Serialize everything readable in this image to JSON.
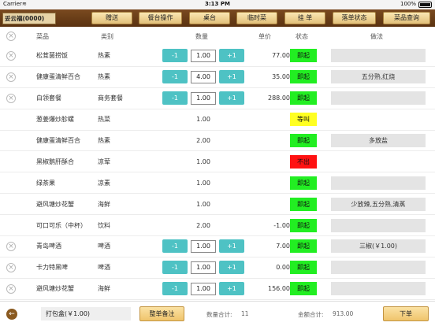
{
  "status_bar": {
    "carrier": "Carrier",
    "time": "3:13 PM",
    "battery": "100%"
  },
  "toolbar": {
    "table_name": "妥云福(0000)",
    "buttons": [
      "赠送",
      "餐台操作",
      "桌台",
      "临时菜",
      "挂 单",
      "落单状态",
      "菜品查询"
    ]
  },
  "header": {
    "name": "菜品",
    "category": "类别",
    "qty": "数量",
    "price": "单价",
    "status": "状态",
    "method": "做法"
  },
  "rows": [
    {
      "name": "松茸菌捞饭",
      "category": "热素",
      "qty": "1.00",
      "price": "77.00",
      "status": "即起",
      "method": "",
      "editable": true,
      "deletable": true,
      "has_method_box": true
    },
    {
      "name": "健康蛋清鲜百合",
      "category": "热素",
      "qty": "4.00",
      "price": "35.00",
      "status": "即起",
      "method": "五分熟,红烧",
      "editable": true,
      "deletable": true,
      "has_method_box": true
    },
    {
      "name": "白领套餐",
      "category": "商务套餐",
      "qty": "1.00",
      "price": "288.00",
      "status": "即起",
      "method": "",
      "editable": true,
      "deletable": true,
      "has_method_box": true
    },
    {
      "name": "葱姜爆炒胗螺",
      "category": "热菜",
      "qty": "1.00",
      "price": "",
      "status": "等叫",
      "method": "",
      "editable": false,
      "deletable": false,
      "has_method_box": false
    },
    {
      "name": "健康蛋清鲜百合",
      "category": "热素",
      "qty": "2.00",
      "price": "",
      "status": "即起",
      "method": "多放盐",
      "editable": false,
      "deletable": false,
      "has_method_box": true
    },
    {
      "name": "黑椒鹅肝酥合",
      "category": "凉荤",
      "qty": "1.00",
      "price": "",
      "status": "不出",
      "method": "",
      "editable": false,
      "deletable": false,
      "has_method_box": false
    },
    {
      "name": "绿茶果",
      "category": "凉素",
      "qty": "1.00",
      "price": "",
      "status": "即起",
      "method": "",
      "editable": false,
      "deletable": false,
      "has_method_box": true
    },
    {
      "name": "避风塘炒花蟹",
      "category": "海鲜",
      "qty": "1.00",
      "price": "",
      "status": "即起",
      "method": "少放辣,五分熟,清蒸",
      "editable": false,
      "deletable": false,
      "has_method_box": true
    },
    {
      "name": "可口可乐（中杯）",
      "category": "饮料",
      "qty": "2.00",
      "price": "-1.00",
      "status": "即起",
      "method": "",
      "editable": false,
      "deletable": false,
      "has_method_box": true
    },
    {
      "name": "青岛啤酒",
      "category": "啤酒",
      "qty": "1.00",
      "price": "7.00",
      "status": "即起",
      "method": "三椒(￥1.00)",
      "editable": true,
      "deletable": true,
      "has_method_box": true
    },
    {
      "name": "卡力特黑啤",
      "category": "啤酒",
      "qty": "1.00",
      "price": "0.00",
      "status": "即起",
      "method": "",
      "editable": true,
      "deletable": true,
      "has_method_box": true
    },
    {
      "name": "避风塘炒花蟹",
      "category": "海鲜",
      "qty": "1.00",
      "price": "156.00",
      "status": "即起",
      "method": "",
      "editable": true,
      "deletable": true,
      "has_method_box": true
    }
  ],
  "stepper": {
    "minus": "-1",
    "plus": "+1"
  },
  "status_colors": {
    "即起": "#22ee22",
    "等叫": "#ffff22",
    "不出": "#ff1111"
  },
  "footer": {
    "pack_fee": "打包盒(￥1.00)",
    "remark_all": "整单备注",
    "qty_total_label": "数量合计:",
    "qty_total": "11",
    "amount_total_label": "金额合计:",
    "amount_total": "913.00",
    "order_button": "下单"
  },
  "icons": {
    "delete": "close-circle-icon",
    "back": "back-arrow-icon",
    "battery": "battery-icon",
    "wifi": "wifi-icon"
  }
}
